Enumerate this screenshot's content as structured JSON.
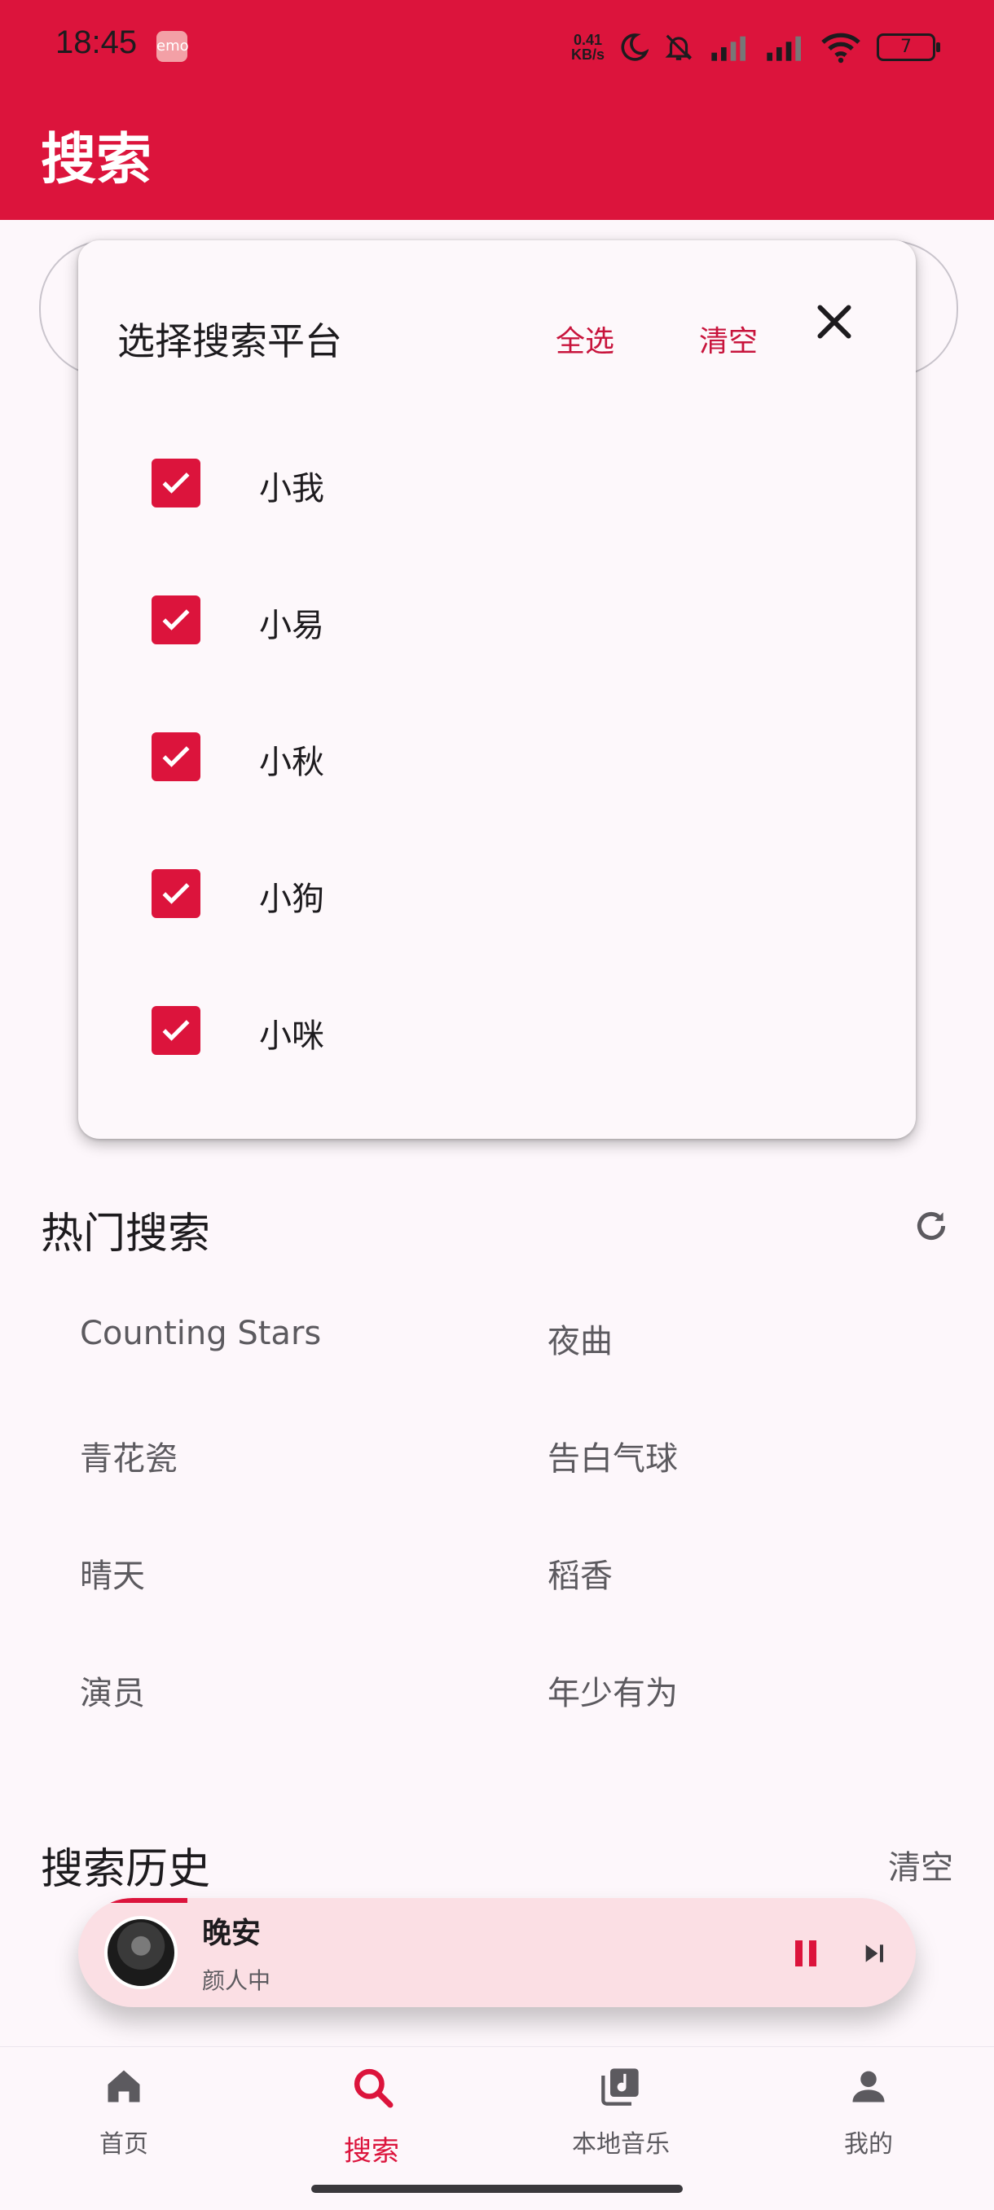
{
  "status": {
    "time": "18:45",
    "app_icon": "emo",
    "netspeed_value": "0.41",
    "netspeed_unit": "KB/s",
    "battery": "7"
  },
  "header": {
    "title": "搜索"
  },
  "platform_dialog": {
    "title": "选择搜索平台",
    "select_all": "全选",
    "clear": "清空",
    "options": [
      {
        "label": "小我",
        "checked": true
      },
      {
        "label": "小易",
        "checked": true
      },
      {
        "label": "小秋",
        "checked": true
      },
      {
        "label": "小狗",
        "checked": true
      },
      {
        "label": "小咪",
        "checked": true
      }
    ]
  },
  "hot": {
    "title": "热门搜索",
    "items": [
      "Counting Stars",
      "夜曲",
      "青花瓷",
      "告白气球",
      "晴天",
      "稻香",
      "演员",
      "年少有为"
    ]
  },
  "history": {
    "title": "搜索历史",
    "clear": "清空"
  },
  "player": {
    "song": "晚安",
    "artist": "颜人中",
    "progress": 0.13
  },
  "nav": {
    "items": [
      "首页",
      "搜索",
      "本地音乐",
      "我的"
    ],
    "active": "搜索"
  },
  "colors": {
    "accent": "#dc143c",
    "background": "#fdf7fb",
    "player_bg": "#fbdfe4"
  }
}
